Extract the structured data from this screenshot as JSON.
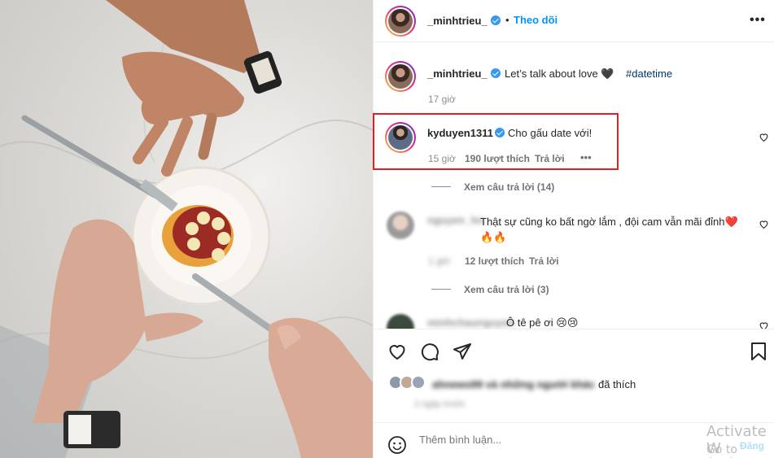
{
  "header": {
    "username": "_minhtrieu_",
    "separator": "•",
    "follow_label": "Theo dõi",
    "more_label": "•••"
  },
  "caption": {
    "username": "_minhtrieu_",
    "text": "Let’s talk about love 🖤",
    "hashtag": "#datetime",
    "time": "17 giờ"
  },
  "comments": [
    {
      "username": "kyduyen1311",
      "text": "Cho gấu date với!",
      "time": "15 giờ",
      "likes": "190 lượt thích",
      "reply_label": "Trả lời",
      "more_label": "•••",
      "view_replies": "Xem câu trả lời (14)"
    },
    {
      "username": "nguyen_hn",
      "text": "Thật sự cũng ko bất ngờ lắm , đội cam vẫn mãi đỉnh❤️ 🔥🔥",
      "time": "1 giờ",
      "likes": "12 lượt thích",
      "reply_label": "Trả lời",
      "view_replies": "Xem câu trả lời (3)"
    },
    {
      "username": "minhchaunguyen",
      "text": "Ô tê pê ơi 😢😢"
    }
  ],
  "likes": {
    "text": "ahnews99 và những người khác",
    "suffix": "đã thích",
    "date": "2 ngày trước"
  },
  "add_comment": {
    "placeholder": "Thêm bình luận...",
    "post_label": "Đăng"
  },
  "watermark": {
    "line1": "Activate W",
    "line2": "Go to Setting"
  },
  "icons": [
    "heart-icon",
    "comment-icon",
    "share-icon",
    "bookmark-icon",
    "emoji-icon"
  ],
  "colors": {
    "accent": "#0095f6",
    "highlight": "#e02020",
    "hashtag": "#00376b"
  }
}
